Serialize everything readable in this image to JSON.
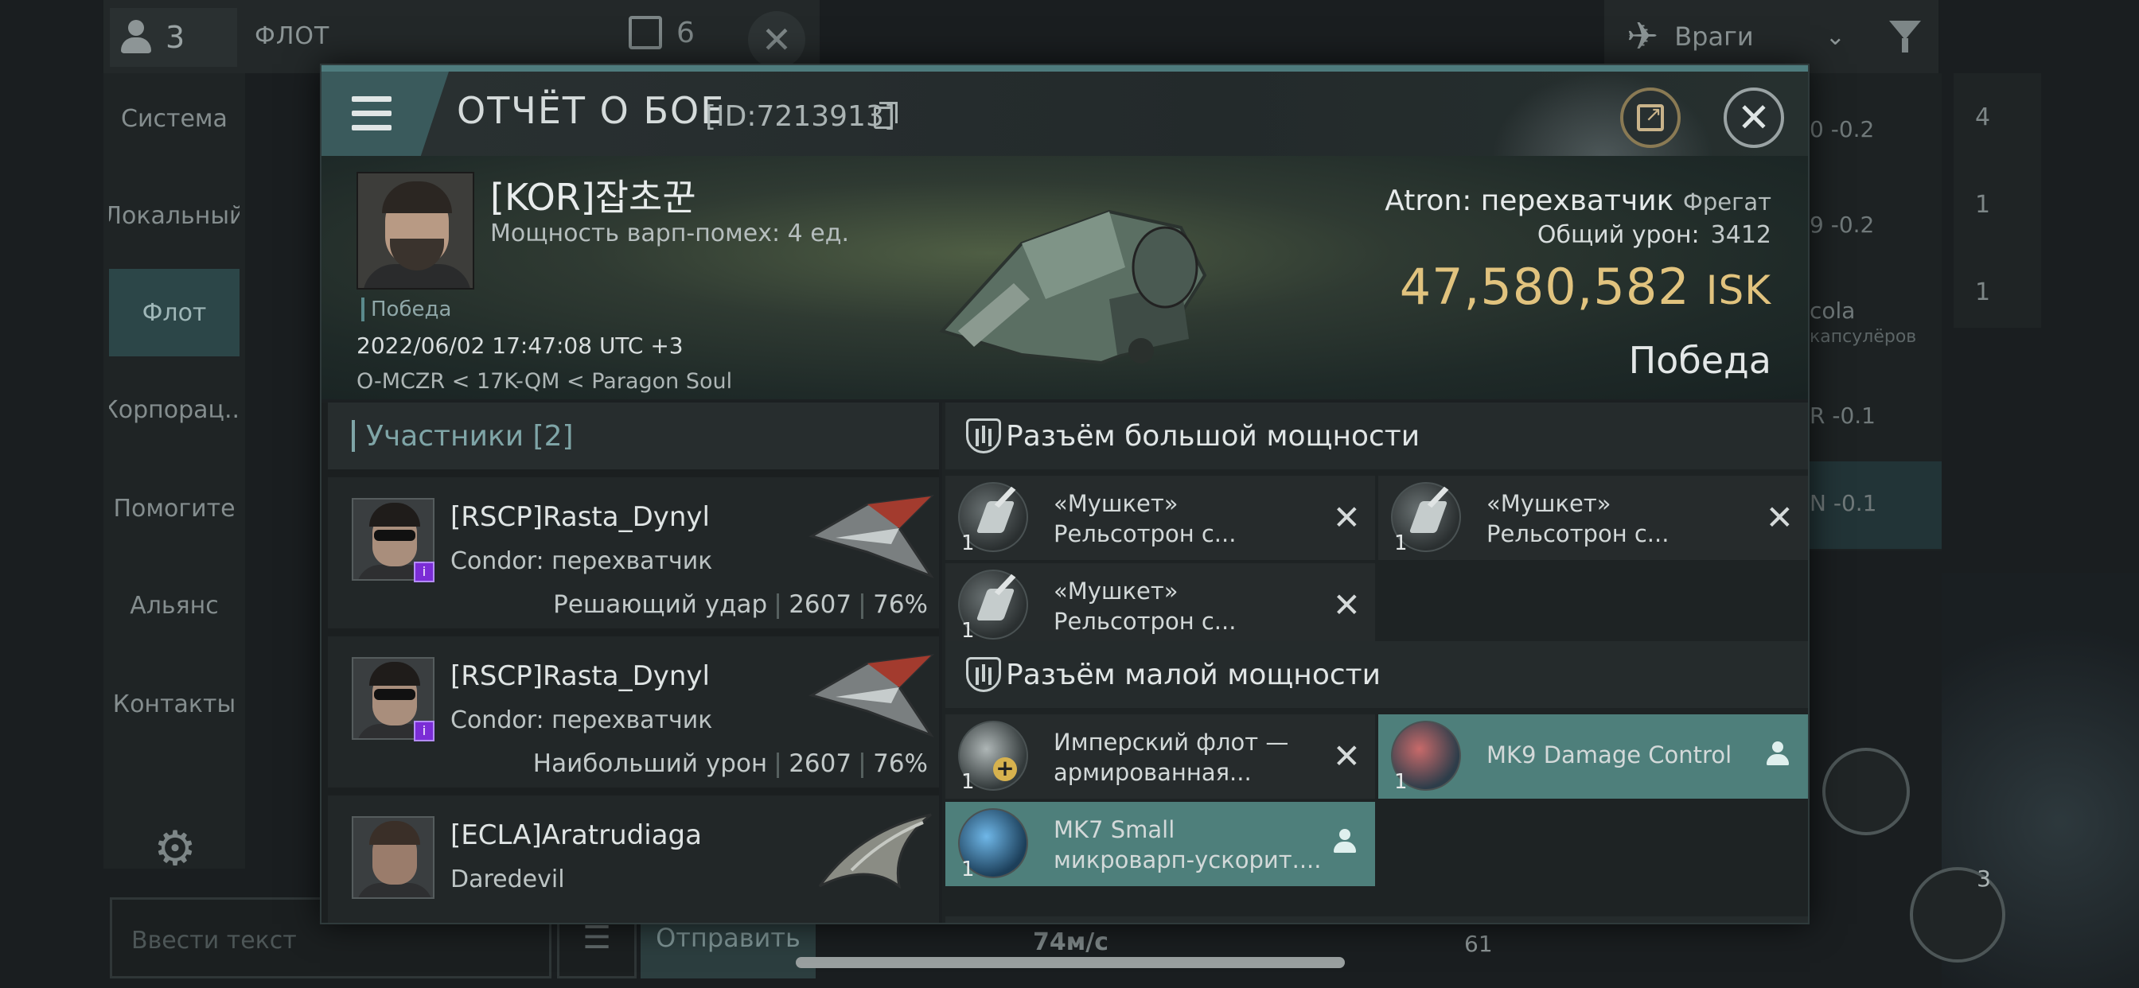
{
  "background": {
    "crew_count": "3",
    "fleet_title": "ФЛОТ",
    "fleet_counter": "6",
    "sidebar": [
      {
        "label": "Система",
        "active": false
      },
      {
        "label": "Локальный",
        "active": false
      },
      {
        "label": "Флот",
        "active": true
      },
      {
        "label": "Корпорац...",
        "active": false
      },
      {
        "label": "Помогите",
        "active": false
      },
      {
        "label": "Альянс",
        "active": false
      },
      {
        "label": "Контакты",
        "active": false
      }
    ],
    "text_input_placeholder": "Ввести текст",
    "send_label": "Отправить",
    "speed": "74м/с",
    "enemies_label": "Враги",
    "overview_rows": [
      {
        "text": "0 -0.2",
        "sub": ""
      },
      {
        "text": "9 -0.2",
        "sub": ""
      },
      {
        "text": "cola",
        "sub": "капсулёров"
      },
      {
        "text": "R -0.1",
        "sub": ""
      },
      {
        "text": "N -0.1",
        "sub": ""
      }
    ],
    "ship_counts": [
      "4",
      "1",
      "1"
    ],
    "module_count_right": "3",
    "module_count_bottom": "61"
  },
  "report": {
    "title": "ОТЧЁТ О БОЕ",
    "id": "[ID:7213913]",
    "victim": {
      "pilot": "[KOR]잡초꾼",
      "warp_strength": "Мощность варп-помех: 4 ед.",
      "result_tag": "Победа",
      "timestamp": "2022/06/02 17:47:08 UTC +3",
      "location": "O-MCZR < 17K-QM < Paragon Soul",
      "ship": "Atron: перехватчик",
      "ship_class": "Фрегат",
      "damage_label": "Общий урон:",
      "damage_value": "3412",
      "isk_value": "47,580,582",
      "isk_unit": "ISK",
      "outcome": "Победа"
    },
    "participants": {
      "header": "Участники [2]",
      "rows": [
        {
          "name": "[RSCP]Rasta_Dynyl",
          "ship": "Condor: перехватчик",
          "role": "Решающий удар",
          "damage": "2607",
          "percent": "76%"
        },
        {
          "name": "[RSCP]Rasta_Dynyl",
          "ship": "Condor: перехватчик",
          "role": "Наибольший урон",
          "damage": "2607",
          "percent": "76%"
        },
        {
          "name": "[ECLA]Aratrudiaga",
          "ship": "Daredevil",
          "role": "",
          "damage": "",
          "percent": ""
        }
      ]
    },
    "fitting": {
      "high_slot_title": "Разъём большой мощности",
      "high_slots": [
        {
          "line1": "«Мушкет»",
          "line2": "Рельсотрон с...",
          "qty": "1",
          "state": "destroyed"
        },
        {
          "line1": "«Мушкет»",
          "line2": "Рельсотрон с...",
          "qty": "1",
          "state": "destroyed"
        },
        {
          "line1": "«Мушкет»",
          "line2": "Рельсотрон с...",
          "qty": "1",
          "state": "destroyed"
        }
      ],
      "low_slot_title": "Разъём малой мощности",
      "low_slots": [
        {
          "line1": "Имперский флот —",
          "line2": "армированная...",
          "qty": "1",
          "state": "destroyed"
        },
        {
          "line1": "MK9 Damage Control",
          "line2": "",
          "qty": "1",
          "state": "dropped"
        },
        {
          "line1": "MK7 Small",
          "line2": "микроварп-ускорит....",
          "qty": "1",
          "state": "dropped"
        }
      ]
    }
  }
}
